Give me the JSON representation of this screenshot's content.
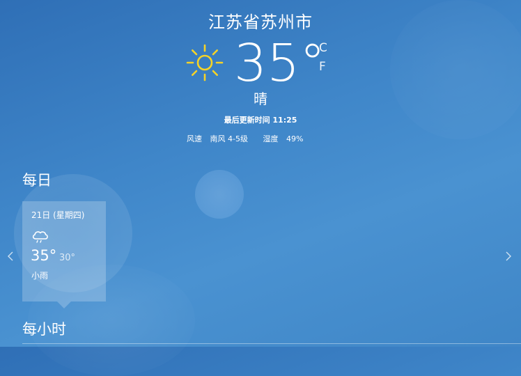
{
  "location": "江苏省苏州市",
  "current": {
    "temperature": "35°",
    "unit_c": "C",
    "unit_f": "F",
    "condition": "晴",
    "icon": "sun-icon",
    "updated": "最后更新时间 11:25",
    "wind_label": "风速",
    "wind_value": "南风 4-5级",
    "humidity_label": "湿度",
    "humidity_value": "49%"
  },
  "daily": {
    "title": "每日",
    "days": [
      {
        "date": "21日 (星期四)",
        "icon": "cloud-rain-icon",
        "high": "35°",
        "low": "30°",
        "condition": "小雨"
      }
    ]
  },
  "hourly": {
    "title": "每小时"
  },
  "colors": {
    "sun": "#f5d327",
    "background": "#3f86c9"
  }
}
